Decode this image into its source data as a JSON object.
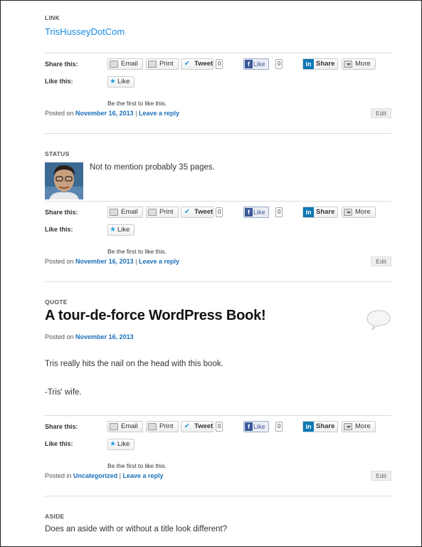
{
  "share_label": "Share this:",
  "like_label": "Like this:",
  "buttons": {
    "email": "Email",
    "print": "Print",
    "tweet": "Tweet",
    "tweet_count": "0",
    "fb_like": "Like",
    "fb_count": "0",
    "linkedin_share": "Share",
    "more": "More",
    "like": "Like"
  },
  "be_first": "Be the first to like this.",
  "edit": "Edit",
  "leave_reply": "Leave a reply",
  "sep": "|",
  "posts": [
    {
      "kind": "LINK",
      "link_text": "TrisHusseyDotCom",
      "meta_prefix": "Posted on",
      "meta_link": "November 16, 2013"
    },
    {
      "kind": "STATUS",
      "status_text": "Not to mention probably 35 pages.",
      "meta_prefix": "Posted on",
      "meta_link": "November 16, 2013"
    },
    {
      "kind": "QUOTE",
      "title": "A tour-de-force WordPress Book!",
      "posted_prefix": "Posted on",
      "posted_date": "November 16, 2013",
      "body_line_1": "Tris really hits the nail on the head with this book.",
      "body_line_2": "-Tris' wife.",
      "meta_prefix": "Posted in",
      "meta_link": "Uncategorized"
    },
    {
      "kind": "ASIDE",
      "body": "Does an aside with or without a title look different?"
    }
  ]
}
